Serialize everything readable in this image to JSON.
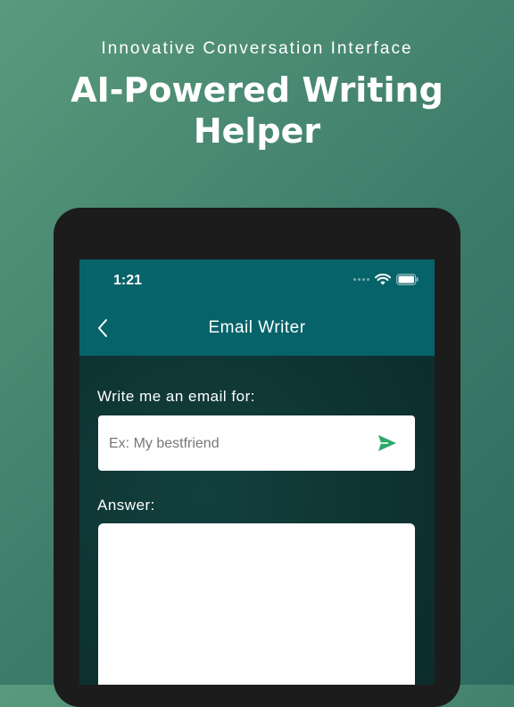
{
  "promo": {
    "subtitle": "Innovative Conversation Interface",
    "title_line1": "AI-Powered Writing",
    "title_line2": "Helper"
  },
  "status_bar": {
    "time": "1:21",
    "icons": [
      "signal-dots-icon",
      "wifi-icon",
      "battery-icon"
    ]
  },
  "app_bar": {
    "title": "Email Writer",
    "back_icon": "chevron-left-icon"
  },
  "form": {
    "prompt_label": "Write me an email for:",
    "input_placeholder": "Ex: My bestfriend",
    "input_value": "",
    "send_icon": "send-icon",
    "answer_label": "Answer:",
    "answer_text": ""
  },
  "colors": {
    "app_bar": "#07636a",
    "send_accent": "#2ea86a",
    "background_start": "#5a9a7c",
    "background_end": "#2e6a60"
  }
}
